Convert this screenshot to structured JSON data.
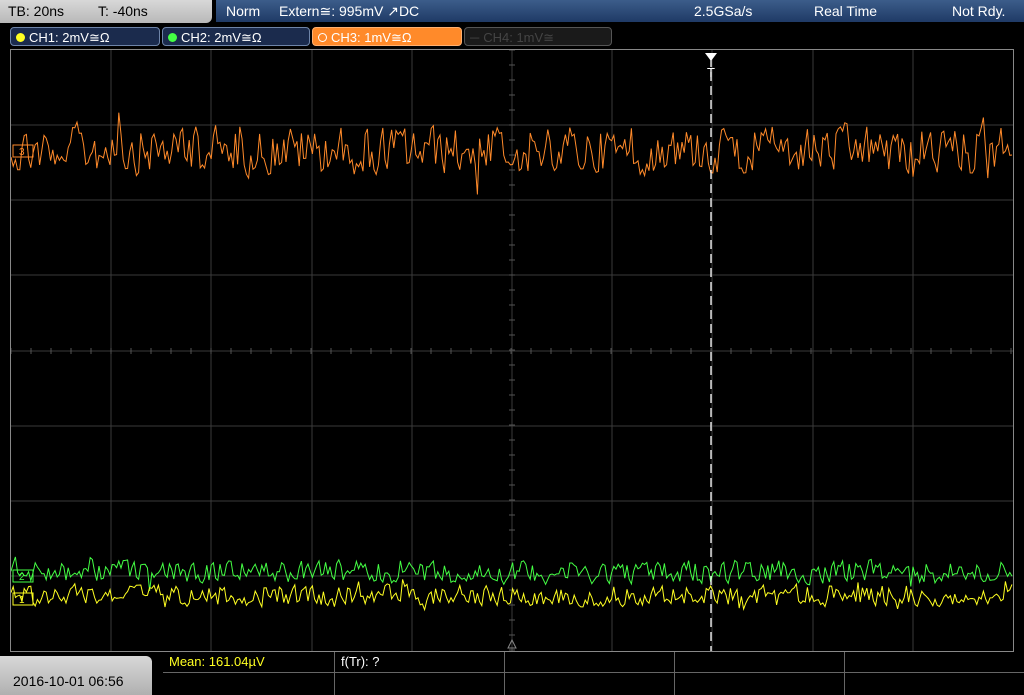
{
  "header": {
    "timebase": "TB: 20ns",
    "trigger_time": "T: -40ns",
    "trigger_mode": "Norm",
    "trigger_source": "Extern≅: 995mV ↗DC",
    "sample_rate": "2.5GSa/s",
    "acquisition": "Real Time",
    "state": "Not Rdy."
  },
  "channels": [
    {
      "id": "CH1",
      "label": "CH1: 2mV≅Ω",
      "color": "#ffff22",
      "active": true
    },
    {
      "id": "CH2",
      "label": "CH2: 2mV≅Ω",
      "color": "#44ff44",
      "active": true
    },
    {
      "id": "CH3",
      "label": "CH3: 1mV≅Ω",
      "color": "#ff8a2a",
      "active": true,
      "selected": true
    },
    {
      "id": "CH4",
      "label": "CH4: 1mV≅",
      "color": "#444444",
      "active": false
    }
  ],
  "markers": {
    "trigger_marker": "T",
    "ch3_marker": "3",
    "ch2_marker": "2",
    "ch1_marker": "1"
  },
  "measurements": {
    "mean_label": "Mean: 161.04µV",
    "freq_label": "f(Tr): ?"
  },
  "timestamp": "2016-10-01 06:56",
  "colors": {
    "grid": "#3a3a3a",
    "status_bar": "#2a4a7a",
    "trigger_line": "#ffffff"
  },
  "icons": [
    "trigger-arrow-icon",
    "ground-marker-icon"
  ]
}
